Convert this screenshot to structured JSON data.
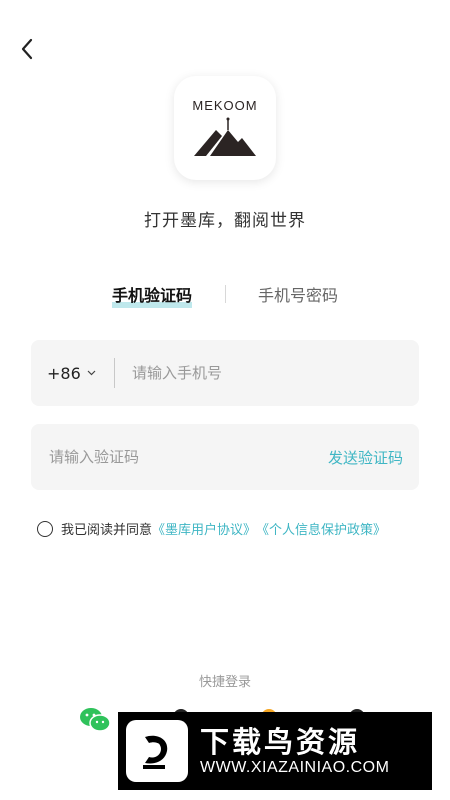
{
  "header": {
    "back_icon": "chevron-left-icon"
  },
  "logo": {
    "text": "MEKOOM",
    "color": "#2b2423"
  },
  "tagline": "打开墨库，翻阅世界",
  "tabs": [
    {
      "label": "手机验证码",
      "active": true
    },
    {
      "label": "手机号密码",
      "active": false
    }
  ],
  "phone": {
    "country_code": "+86",
    "placeholder": "请输入手机号",
    "value": ""
  },
  "code": {
    "placeholder": "请输入验证码",
    "value": "",
    "send_label": "发送验证码"
  },
  "agreement": {
    "prefix": "我已阅读并同意",
    "link1": "《墨库用户协议》",
    "link2": "《个人信息保护政策》",
    "checked": false
  },
  "quick_login": {
    "label": "快捷登录",
    "icons": [
      "wechat-icon",
      "qq-icon",
      "weibo-icon",
      "apple-icon"
    ]
  },
  "watermark": {
    "title": "下载鸟资源",
    "url": "WWW.XIAZAINIAO.COM"
  },
  "colors": {
    "accent": "#3fb6c4",
    "tab_underline": "#bfe8ec",
    "field_bg": "#f5f5f5"
  }
}
